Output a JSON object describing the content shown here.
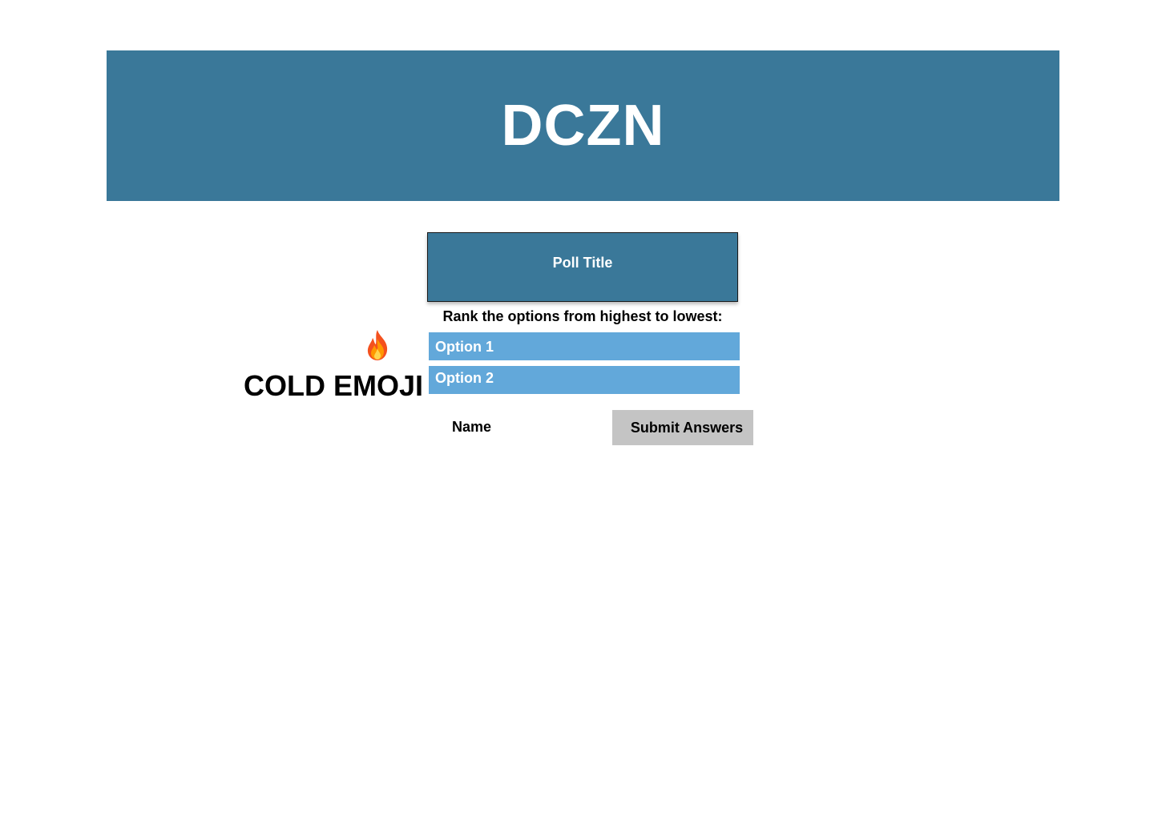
{
  "header": {
    "site_title": "DCZN",
    "background_color": "#3a7899"
  },
  "poll": {
    "title": "Poll Title",
    "instructions": "Rank the options from highest to lowest:",
    "options": [
      {
        "label": "Option 1"
      },
      {
        "label": "Option 2"
      }
    ],
    "option_color": "#62a8da"
  },
  "side_panel": {
    "icon": "fire-icon",
    "label": "COLD EMOJI"
  },
  "form": {
    "name_label": "Name",
    "submit_label": "Submit Answers",
    "submit_color": "#c4c4c4"
  }
}
